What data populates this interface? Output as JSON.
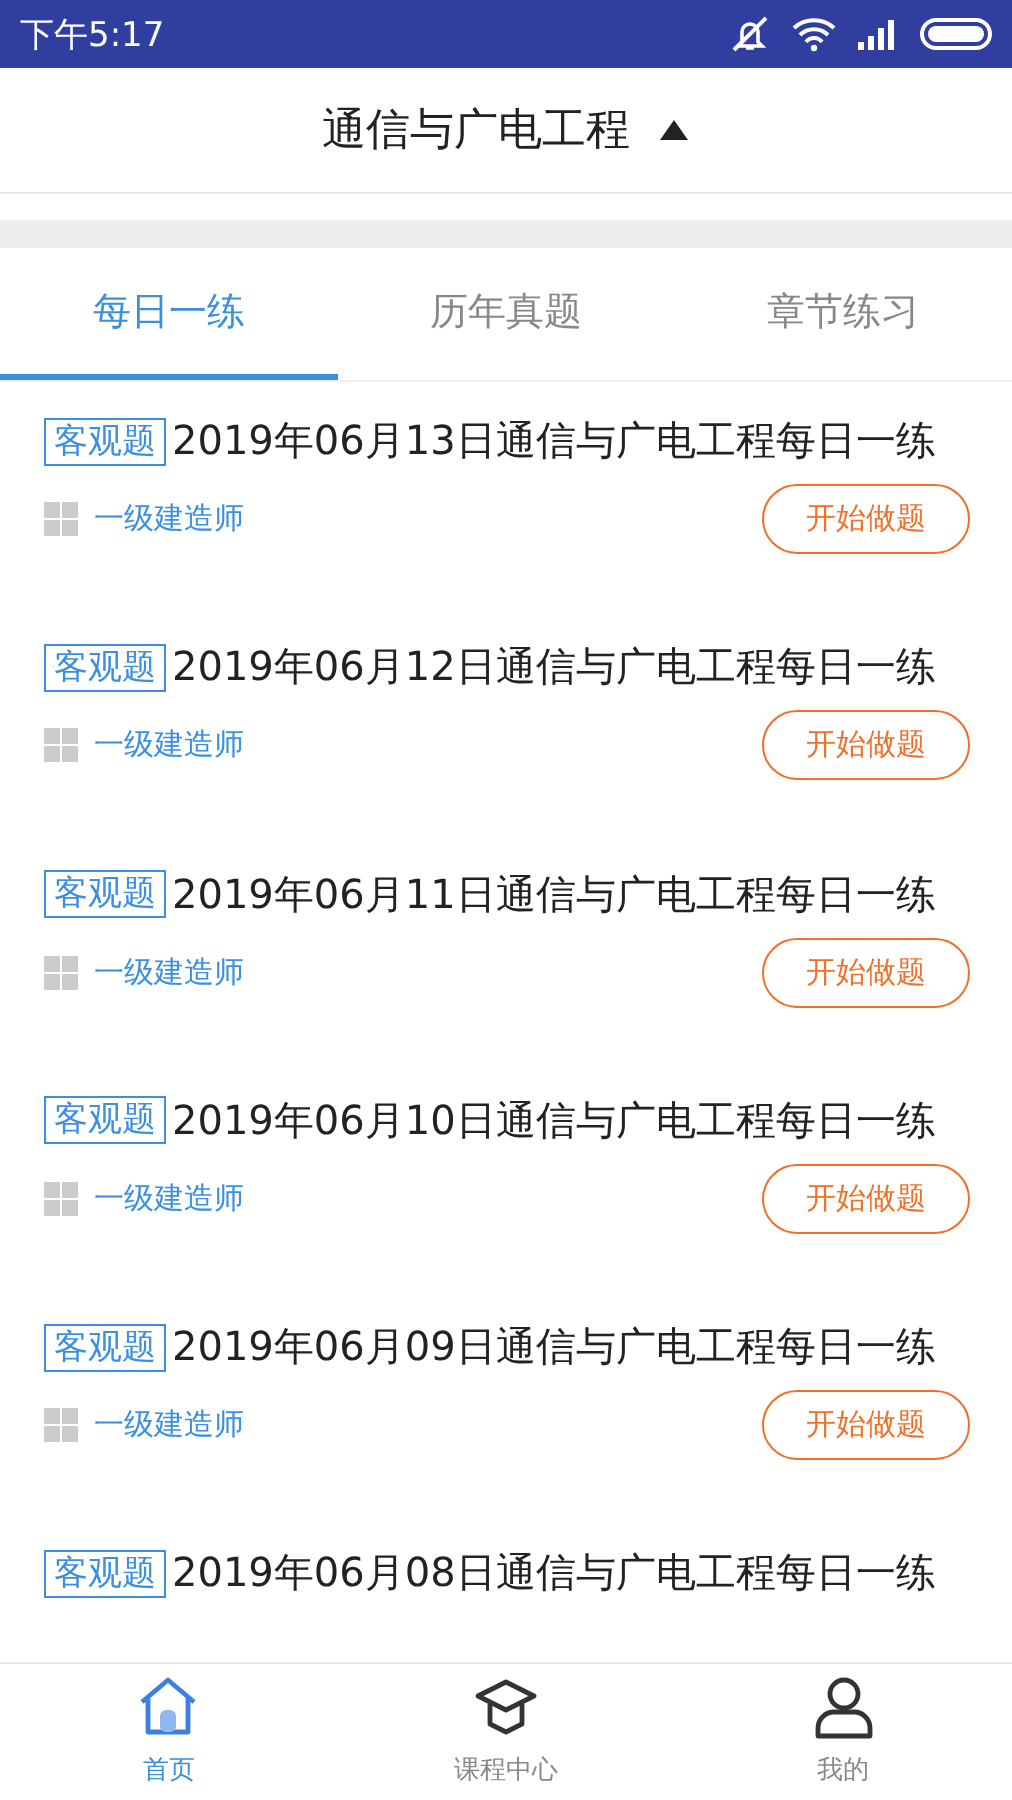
{
  "status_bar": {
    "time": "下午5:17"
  },
  "header": {
    "title": "通信与广电工程",
    "expanded": true
  },
  "tabs": [
    {
      "label": "每日一练",
      "selected": true
    },
    {
      "label": "历年真题",
      "selected": false
    },
    {
      "label": "章节练习",
      "selected": false
    }
  ],
  "items": [
    {
      "tag": "客观题",
      "title": "2019年06月13日通信与广电工程每日一练",
      "category": "一级建造师",
      "button": "开始做题"
    },
    {
      "tag": "客观题",
      "title": "2019年06月12日通信与广电工程每日一练",
      "category": "一级建造师",
      "button": "开始做题"
    },
    {
      "tag": "客观题",
      "title": "2019年06月11日通信与广电工程每日一练",
      "category": "一级建造师",
      "button": "开始做题"
    },
    {
      "tag": "客观题",
      "title": "2019年06月10日通信与广电工程每日一练",
      "category": "一级建造师",
      "button": "开始做题"
    },
    {
      "tag": "客观题",
      "title": "2019年06月09日通信与广电工程每日一练",
      "category": "一级建造师",
      "button": "开始做题"
    },
    {
      "tag": "客观题",
      "title": "2019年06月08日通信与广电工程每日一练"
    }
  ],
  "bottom_nav": [
    {
      "label": "首页",
      "kind": "home",
      "selected": true
    },
    {
      "label": "课程中心",
      "kind": "cap",
      "selected": false
    },
    {
      "label": "我的",
      "kind": "person",
      "selected": false
    }
  ]
}
